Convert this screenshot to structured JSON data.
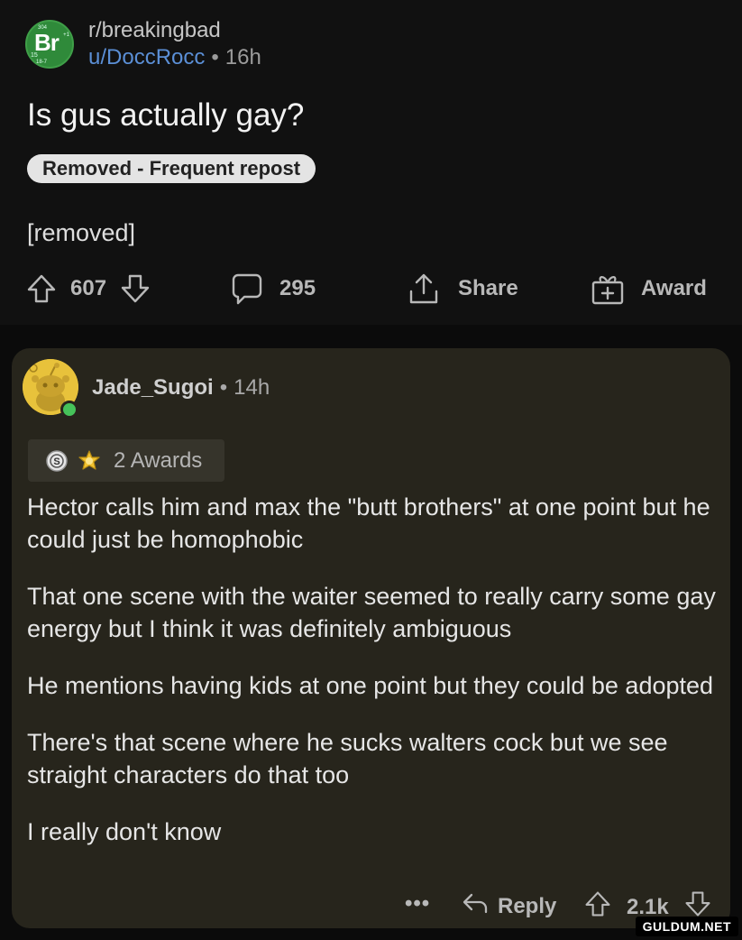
{
  "post": {
    "subreddit": "r/breakingbad",
    "subreddit_avatar": {
      "symbol": "Br",
      "number_top": "304",
      "number_left": "15",
      "number_right": "+1",
      "number_bottom": "18-7"
    },
    "username": "u/DoccRocc",
    "separator": "•",
    "age": "16h",
    "title": "Is gus actually gay?",
    "flair": "Removed - Frequent repost",
    "body": "[removed]",
    "upvotes": "607",
    "comments": "295",
    "share_label": "Share",
    "award_label": "Award"
  },
  "comment": {
    "username": "Jade_Sugoi",
    "separator": "•",
    "age": "14h",
    "awards_label": "2 Awards",
    "paragraphs": [
      "Hector calls him and max the \"butt brothers\" at one point but he could just be homophobic",
      "That one scene with the waiter seemed to really carry some gay energy but I think it was definitely ambiguous",
      "He mentions having kids at one point but they could be adopted",
      "There's that scene where he sucks walters cock but we see straight characters do that too",
      "I really don't know"
    ],
    "more_label": "•••",
    "reply_label": "Reply",
    "score": "2.1k"
  },
  "watermark": "GULDUM.NET",
  "colors": {
    "background": "#0b0b0b",
    "post_background": "#111111",
    "comment_background": "#27251c",
    "username_blue": "#5b8fd6",
    "subreddit_green": "#2f8a3a",
    "avatar_yellow": "#e8c23b",
    "online_green": "#46c35a"
  }
}
